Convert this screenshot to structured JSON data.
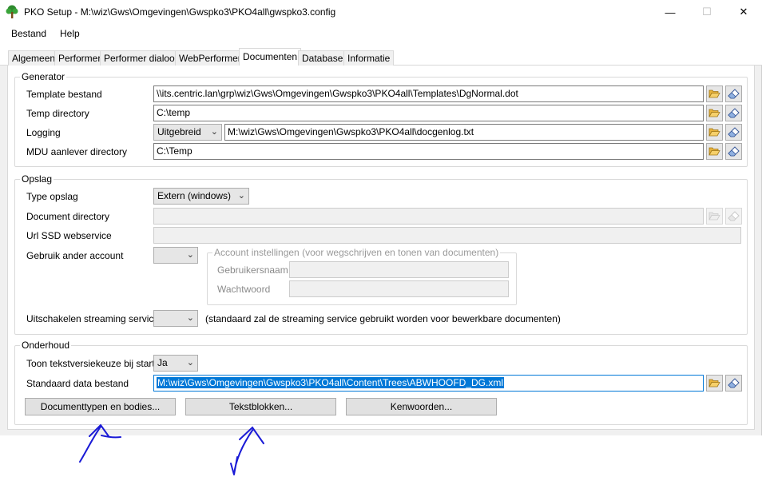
{
  "window": {
    "title": "PKO Setup - M:\\wiz\\Gws\\Omgevingen\\Gwspko3\\PKO4all\\gwspko3.config",
    "minimize": "—",
    "maximize": "☐",
    "close": "✕"
  },
  "menu": {
    "file": "Bestand",
    "help": "Help"
  },
  "tabs": [
    {
      "label": "Algemeen"
    },
    {
      "label": "Performer"
    },
    {
      "label": "Performer dialoog"
    },
    {
      "label": "WebPerformer"
    },
    {
      "label": "Documenten"
    },
    {
      "label": "Database"
    },
    {
      "label": "Informatie"
    }
  ],
  "generator": {
    "title": "Generator",
    "template_label": "Template bestand",
    "template_value": "\\\\its.centric.lan\\grp\\wiz\\Gws\\Omgevingen\\Gwspko3\\PKO4all\\Templates\\DgNormal.dot",
    "temp_label": "Temp directory",
    "temp_value": "C:\\temp",
    "logging_label": "Logging",
    "logging_level": "Uitgebreid",
    "logging_value": "M:\\wiz\\Gws\\Omgevingen\\Gwspko3\\PKO4all\\docgenlog.txt",
    "mdu_label": "MDU aanlever directory",
    "mdu_value": "C:\\Temp"
  },
  "opslag": {
    "title": "Opslag",
    "type_label": "Type opslag",
    "type_value": "Extern (windows)",
    "docdir_label": "Document directory",
    "docdir_value": "",
    "url_label": "Url SSD webservice",
    "url_value": "",
    "account_label": "Gebruik ander account",
    "account_value": "",
    "account_group_title": "Account instellingen (voor wegschrijven en tonen van documenten)",
    "username_label": "Gebruikersnaam",
    "password_label": "Wachtwoord",
    "streaming_label": "Uitschakelen streaming service",
    "streaming_value": "",
    "streaming_note": "(standaard zal de streaming service gebruikt worden voor bewerkbare documenten)"
  },
  "onderhoud": {
    "title": "Onderhoud",
    "toon_label": "Toon tekstversiekeuze bij start",
    "toon_value": "Ja",
    "data_label": "Standaard data bestand",
    "data_value": "M:\\wiz\\Gws\\Omgevingen\\Gwspko3\\PKO4all\\Content\\Trees\\ABWHOOFD_DG.xml",
    "btn_doctypes": "Documenttypen en bodies...",
    "btn_tekstblokken": "Tekstblokken...",
    "btn_kenwoorden": "Kenwoorden..."
  },
  "colors": {
    "selection": "#0078d7",
    "annotation": "#1a1ad6"
  }
}
